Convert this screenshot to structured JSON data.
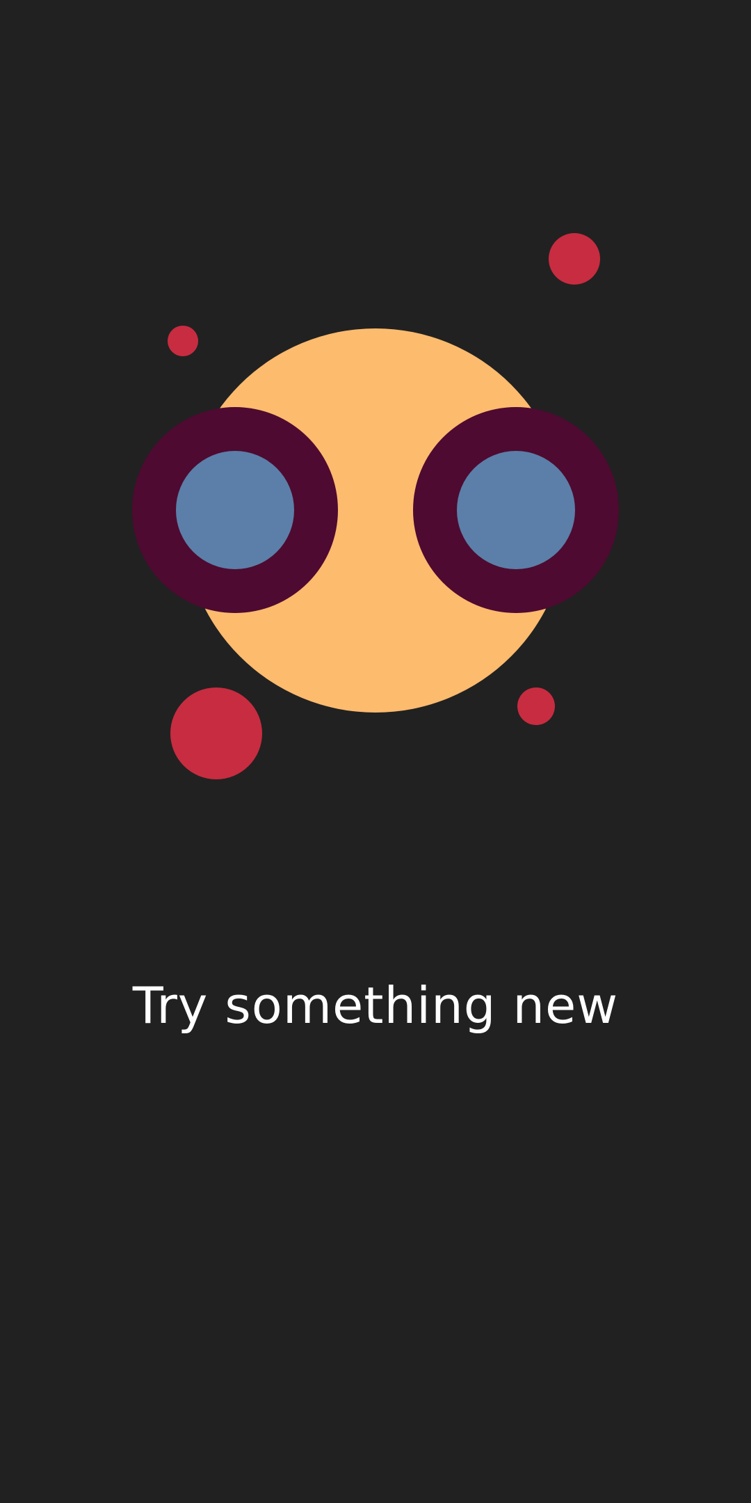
{
  "screen": {
    "headline": "Try something new"
  },
  "colors": {
    "background": "#212121",
    "face": "#FDBB6E",
    "eye_ring": "#4E0A30",
    "eye_lens": "#5B7FA8",
    "dots": "#C82C40",
    "text": "#FFFFFF"
  },
  "icons": {
    "illustration": "goggle-face-icon"
  }
}
